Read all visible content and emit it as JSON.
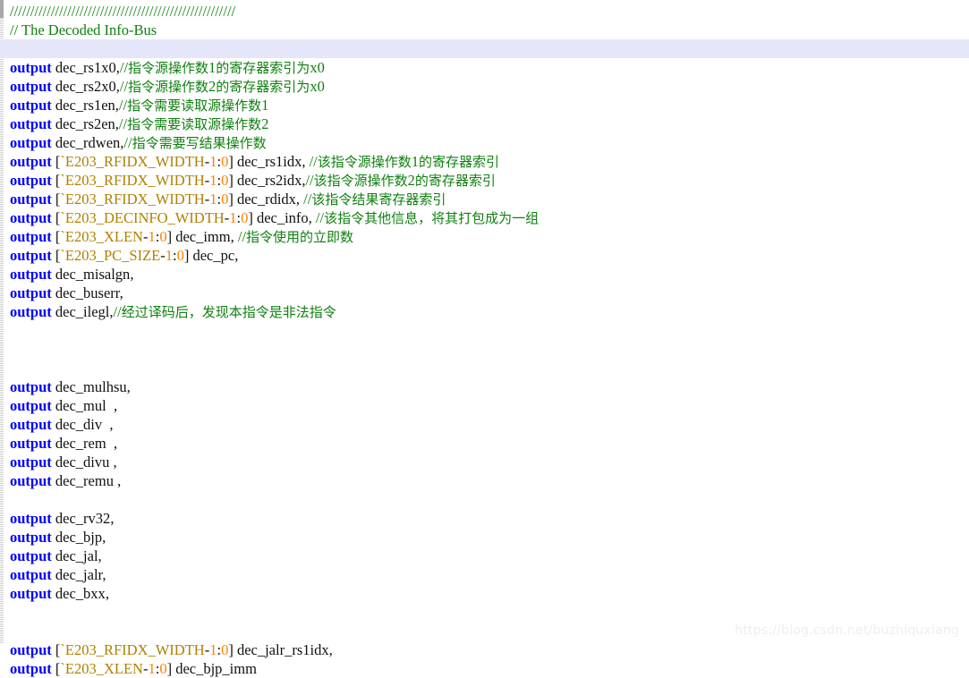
{
  "editor": {
    "language": "verilog",
    "highlighted_line_index": 2,
    "colors": {
      "background": "#ffffff",
      "comment": "#108010",
      "keyword": "#0000ff",
      "identifier": "#101010",
      "macro": "#b08000",
      "number": "#ff8000",
      "punctuation": "#101010",
      "current_line_highlight": "#e6e6fa",
      "watermark": "#eeeeee"
    }
  },
  "watermark": {
    "text": "https://blog.csdn.net/buzhiquxiang"
  },
  "lines": [
    {
      "tokens": [
        {
          "t": "comment",
          "v": "///////////////////////////////////////////////////////"
        }
      ]
    },
    {
      "tokens": [
        {
          "t": "comment",
          "v": "// The Decoded Info-Bus"
        }
      ]
    },
    {
      "highlight": true,
      "tokens": []
    },
    {
      "tokens": [
        {
          "t": "keyword",
          "v": "output"
        },
        {
          "t": "plain",
          "v": " "
        },
        {
          "t": "ident",
          "v": "dec_rs1x0"
        },
        {
          "t": "punct",
          "v": ","
        },
        {
          "t": "comment",
          "v": "//"
        },
        {
          "t": "comment-cjk",
          "v": "指令源操作数"
        },
        {
          "t": "comment",
          "v": "1"
        },
        {
          "t": "comment-cjk",
          "v": "的寄存器索引为"
        },
        {
          "t": "comment",
          "v": "x0"
        }
      ]
    },
    {
      "tokens": [
        {
          "t": "keyword",
          "v": "output"
        },
        {
          "t": "plain",
          "v": " "
        },
        {
          "t": "ident",
          "v": "dec_rs2x0"
        },
        {
          "t": "punct",
          "v": ","
        },
        {
          "t": "comment",
          "v": "//"
        },
        {
          "t": "comment-cjk",
          "v": "指令源操作数"
        },
        {
          "t": "comment",
          "v": "2"
        },
        {
          "t": "comment-cjk",
          "v": "的寄存器索引为"
        },
        {
          "t": "comment",
          "v": "x0"
        }
      ]
    },
    {
      "tokens": [
        {
          "t": "keyword",
          "v": "output"
        },
        {
          "t": "plain",
          "v": " "
        },
        {
          "t": "ident",
          "v": "dec_rs1en"
        },
        {
          "t": "punct",
          "v": ","
        },
        {
          "t": "comment",
          "v": "//"
        },
        {
          "t": "comment-cjk",
          "v": "指令需要读取源操作数"
        },
        {
          "t": "comment",
          "v": "1"
        }
      ]
    },
    {
      "tokens": [
        {
          "t": "keyword",
          "v": "output"
        },
        {
          "t": "plain",
          "v": " "
        },
        {
          "t": "ident",
          "v": "dec_rs2en"
        },
        {
          "t": "punct",
          "v": ","
        },
        {
          "t": "comment",
          "v": "//"
        },
        {
          "t": "comment-cjk",
          "v": "指令需要读取源操作数"
        },
        {
          "t": "comment",
          "v": "2"
        }
      ]
    },
    {
      "tokens": [
        {
          "t": "keyword",
          "v": "output"
        },
        {
          "t": "plain",
          "v": " "
        },
        {
          "t": "ident",
          "v": "dec_rdwen"
        },
        {
          "t": "punct",
          "v": ","
        },
        {
          "t": "comment",
          "v": "//"
        },
        {
          "t": "comment-cjk",
          "v": "指令需要写结果操作数"
        }
      ]
    },
    {
      "tokens": [
        {
          "t": "keyword",
          "v": "output"
        },
        {
          "t": "plain",
          "v": " "
        },
        {
          "t": "punct",
          "v": "["
        },
        {
          "t": "macro",
          "v": "`E203_RFIDX_WIDTH"
        },
        {
          "t": "punct",
          "v": "-"
        },
        {
          "t": "number",
          "v": "1"
        },
        {
          "t": "punct",
          "v": ":"
        },
        {
          "t": "number",
          "v": "0"
        },
        {
          "t": "punct",
          "v": "]"
        },
        {
          "t": "plain",
          "v": " "
        },
        {
          "t": "ident",
          "v": "dec_rs1idx"
        },
        {
          "t": "punct",
          "v": ", "
        },
        {
          "t": "comment",
          "v": "//"
        },
        {
          "t": "comment-cjk",
          "v": "该指令源操作数"
        },
        {
          "t": "comment",
          "v": "1"
        },
        {
          "t": "comment-cjk",
          "v": "的寄存器索引"
        }
      ]
    },
    {
      "tokens": [
        {
          "t": "keyword",
          "v": "output"
        },
        {
          "t": "plain",
          "v": " "
        },
        {
          "t": "punct",
          "v": "["
        },
        {
          "t": "macro",
          "v": "`E203_RFIDX_WIDTH"
        },
        {
          "t": "punct",
          "v": "-"
        },
        {
          "t": "number",
          "v": "1"
        },
        {
          "t": "punct",
          "v": ":"
        },
        {
          "t": "number",
          "v": "0"
        },
        {
          "t": "punct",
          "v": "]"
        },
        {
          "t": "plain",
          "v": " "
        },
        {
          "t": "ident",
          "v": "dec_rs2idx"
        },
        {
          "t": "punct",
          "v": ","
        },
        {
          "t": "comment",
          "v": "//"
        },
        {
          "t": "comment-cjk",
          "v": "该指令源操作数"
        },
        {
          "t": "comment",
          "v": "2"
        },
        {
          "t": "comment-cjk",
          "v": "的寄存器索引"
        }
      ]
    },
    {
      "tokens": [
        {
          "t": "keyword",
          "v": "output"
        },
        {
          "t": "plain",
          "v": " "
        },
        {
          "t": "punct",
          "v": "["
        },
        {
          "t": "macro",
          "v": "`E203_RFIDX_WIDTH"
        },
        {
          "t": "punct",
          "v": "-"
        },
        {
          "t": "number",
          "v": "1"
        },
        {
          "t": "punct",
          "v": ":"
        },
        {
          "t": "number",
          "v": "0"
        },
        {
          "t": "punct",
          "v": "]"
        },
        {
          "t": "plain",
          "v": " "
        },
        {
          "t": "ident",
          "v": "dec_rdidx"
        },
        {
          "t": "punct",
          "v": ", "
        },
        {
          "t": "comment",
          "v": "//"
        },
        {
          "t": "comment-cjk",
          "v": "该指令结果寄存器索引"
        }
      ]
    },
    {
      "tokens": [
        {
          "t": "keyword",
          "v": "output"
        },
        {
          "t": "plain",
          "v": " "
        },
        {
          "t": "punct",
          "v": "["
        },
        {
          "t": "macro",
          "v": "`E203_DECINFO_WIDTH"
        },
        {
          "t": "punct",
          "v": "-"
        },
        {
          "t": "number",
          "v": "1"
        },
        {
          "t": "punct",
          "v": ":"
        },
        {
          "t": "number",
          "v": "0"
        },
        {
          "t": "punct",
          "v": "]"
        },
        {
          "t": "plain",
          "v": " "
        },
        {
          "t": "ident",
          "v": "dec_info"
        },
        {
          "t": "punct",
          "v": ", "
        },
        {
          "t": "comment",
          "v": "//"
        },
        {
          "t": "comment-cjk",
          "v": "该指令其他信息，将其打包成为一组"
        }
      ]
    },
    {
      "tokens": [
        {
          "t": "keyword",
          "v": "output"
        },
        {
          "t": "plain",
          "v": " "
        },
        {
          "t": "punct",
          "v": "["
        },
        {
          "t": "macro",
          "v": "`E203_XLEN"
        },
        {
          "t": "punct",
          "v": "-"
        },
        {
          "t": "number",
          "v": "1"
        },
        {
          "t": "punct",
          "v": ":"
        },
        {
          "t": "number",
          "v": "0"
        },
        {
          "t": "punct",
          "v": "]"
        },
        {
          "t": "plain",
          "v": " "
        },
        {
          "t": "ident",
          "v": "dec_imm"
        },
        {
          "t": "punct",
          "v": ", "
        },
        {
          "t": "comment",
          "v": "//"
        },
        {
          "t": "comment-cjk",
          "v": "指令使用的立即数"
        }
      ]
    },
    {
      "tokens": [
        {
          "t": "keyword",
          "v": "output"
        },
        {
          "t": "plain",
          "v": " "
        },
        {
          "t": "punct",
          "v": "["
        },
        {
          "t": "macro",
          "v": "`E203_PC_SIZE"
        },
        {
          "t": "punct",
          "v": "-"
        },
        {
          "t": "number",
          "v": "1"
        },
        {
          "t": "punct",
          "v": ":"
        },
        {
          "t": "number",
          "v": "0"
        },
        {
          "t": "punct",
          "v": "]"
        },
        {
          "t": "plain",
          "v": " "
        },
        {
          "t": "ident",
          "v": "dec_pc"
        },
        {
          "t": "punct",
          "v": ","
        }
      ]
    },
    {
      "tokens": [
        {
          "t": "keyword",
          "v": "output"
        },
        {
          "t": "plain",
          "v": " "
        },
        {
          "t": "ident",
          "v": "dec_misalgn"
        },
        {
          "t": "punct",
          "v": ","
        }
      ]
    },
    {
      "tokens": [
        {
          "t": "keyword",
          "v": "output"
        },
        {
          "t": "plain",
          "v": " "
        },
        {
          "t": "ident",
          "v": "dec_buserr"
        },
        {
          "t": "punct",
          "v": ","
        }
      ]
    },
    {
      "tokens": [
        {
          "t": "keyword",
          "v": "output"
        },
        {
          "t": "plain",
          "v": " "
        },
        {
          "t": "ident",
          "v": "dec_ilegl"
        },
        {
          "t": "punct",
          "v": ","
        },
        {
          "t": "comment",
          "v": "//"
        },
        {
          "t": "comment-cjk",
          "v": "经过译码后，发现本指令是非法指令"
        }
      ]
    },
    {
      "tokens": []
    },
    {
      "tokens": []
    },
    {
      "tokens": []
    },
    {
      "tokens": [
        {
          "t": "keyword",
          "v": "output"
        },
        {
          "t": "plain",
          "v": " "
        },
        {
          "t": "ident",
          "v": "dec_mulhsu"
        },
        {
          "t": "punct",
          "v": ","
        }
      ]
    },
    {
      "tokens": [
        {
          "t": "keyword",
          "v": "output"
        },
        {
          "t": "plain",
          "v": " "
        },
        {
          "t": "ident",
          "v": "dec_mul"
        },
        {
          "t": "plain",
          "v": "  "
        },
        {
          "t": "punct",
          "v": ","
        }
      ]
    },
    {
      "tokens": [
        {
          "t": "keyword",
          "v": "output"
        },
        {
          "t": "plain",
          "v": " "
        },
        {
          "t": "ident",
          "v": "dec_div"
        },
        {
          "t": "plain",
          "v": "  "
        },
        {
          "t": "punct",
          "v": ","
        }
      ]
    },
    {
      "tokens": [
        {
          "t": "keyword",
          "v": "output"
        },
        {
          "t": "plain",
          "v": " "
        },
        {
          "t": "ident",
          "v": "dec_rem"
        },
        {
          "t": "plain",
          "v": "  "
        },
        {
          "t": "punct",
          "v": ","
        }
      ]
    },
    {
      "tokens": [
        {
          "t": "keyword",
          "v": "output"
        },
        {
          "t": "plain",
          "v": " "
        },
        {
          "t": "ident",
          "v": "dec_divu"
        },
        {
          "t": "plain",
          "v": " "
        },
        {
          "t": "punct",
          "v": ","
        }
      ]
    },
    {
      "tokens": [
        {
          "t": "keyword",
          "v": "output"
        },
        {
          "t": "plain",
          "v": " "
        },
        {
          "t": "ident",
          "v": "dec_remu"
        },
        {
          "t": "plain",
          "v": " "
        },
        {
          "t": "punct",
          "v": ","
        }
      ]
    },
    {
      "tokens": []
    },
    {
      "tokens": [
        {
          "t": "keyword",
          "v": "output"
        },
        {
          "t": "plain",
          "v": " "
        },
        {
          "t": "ident",
          "v": "dec_rv32"
        },
        {
          "t": "punct",
          "v": ","
        }
      ]
    },
    {
      "tokens": [
        {
          "t": "keyword",
          "v": "output"
        },
        {
          "t": "plain",
          "v": " "
        },
        {
          "t": "ident",
          "v": "dec_bjp"
        },
        {
          "t": "punct",
          "v": ","
        }
      ]
    },
    {
      "tokens": [
        {
          "t": "keyword",
          "v": "output"
        },
        {
          "t": "plain",
          "v": " "
        },
        {
          "t": "ident",
          "v": "dec_jal"
        },
        {
          "t": "punct",
          "v": ","
        }
      ]
    },
    {
      "tokens": [
        {
          "t": "keyword",
          "v": "output"
        },
        {
          "t": "plain",
          "v": " "
        },
        {
          "t": "ident",
          "v": "dec_jalr"
        },
        {
          "t": "punct",
          "v": ","
        }
      ]
    },
    {
      "tokens": [
        {
          "t": "keyword",
          "v": "output"
        },
        {
          "t": "plain",
          "v": " "
        },
        {
          "t": "ident",
          "v": "dec_bxx"
        },
        {
          "t": "punct",
          "v": ","
        }
      ]
    },
    {
      "tokens": []
    },
    {
      "tokens": []
    },
    {
      "tokens": [
        {
          "t": "keyword",
          "v": "output"
        },
        {
          "t": "plain",
          "v": " "
        },
        {
          "t": "punct",
          "v": "["
        },
        {
          "t": "macro",
          "v": "`E203_RFIDX_WIDTH"
        },
        {
          "t": "punct",
          "v": "-"
        },
        {
          "t": "number",
          "v": "1"
        },
        {
          "t": "punct",
          "v": ":"
        },
        {
          "t": "number",
          "v": "0"
        },
        {
          "t": "punct",
          "v": "]"
        },
        {
          "t": "plain",
          "v": " "
        },
        {
          "t": "ident",
          "v": "dec_jalr_rs1idx"
        },
        {
          "t": "punct",
          "v": ","
        }
      ]
    },
    {
      "tokens": [
        {
          "t": "keyword",
          "v": "output"
        },
        {
          "t": "plain",
          "v": " "
        },
        {
          "t": "punct",
          "v": "["
        },
        {
          "t": "macro",
          "v": "`E203_XLEN"
        },
        {
          "t": "punct",
          "v": "-"
        },
        {
          "t": "number",
          "v": "1"
        },
        {
          "t": "punct",
          "v": ":"
        },
        {
          "t": "number",
          "v": "0"
        },
        {
          "t": "punct",
          "v": "]"
        },
        {
          "t": "plain",
          "v": " "
        },
        {
          "t": "ident",
          "v": "dec_bjp_imm"
        }
      ]
    }
  ]
}
